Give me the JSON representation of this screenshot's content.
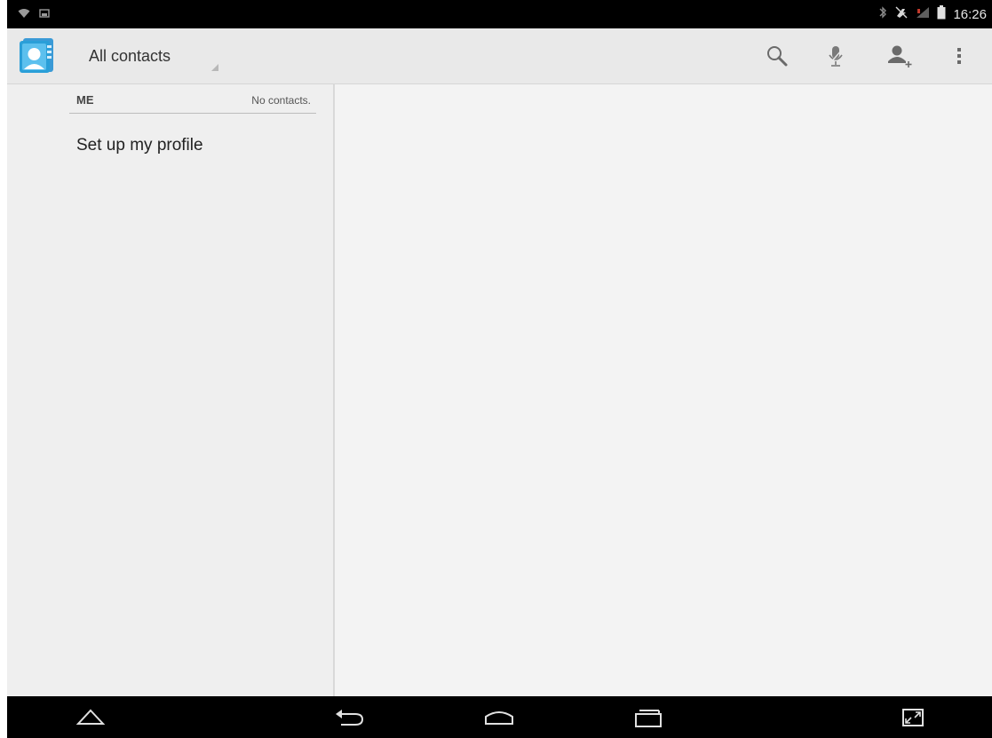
{
  "status_bar": {
    "time": "16:26",
    "icons": [
      "wifi-icon",
      "screenshot-notification-icon",
      "bluetooth-icon",
      "mute-icon",
      "signal-icon",
      "battery-icon"
    ]
  },
  "action_bar": {
    "app_icon": "contacts-app-icon",
    "filter_label": "All contacts",
    "actions": [
      "search-icon",
      "voice-search-icon",
      "add-contact-icon",
      "overflow-menu-icon"
    ]
  },
  "list": {
    "section_title": "ME",
    "section_count": "No contacts.",
    "profile_label": "Set up my profile"
  },
  "nav_bar": {
    "buttons": [
      "up-icon",
      "back-icon",
      "home-icon",
      "recent-apps-icon",
      "compatibility-zoom-icon"
    ]
  },
  "colors": {
    "status_bar": "#000000",
    "action_bar": "#e9e9e9",
    "list_pane": "#efefef",
    "detail_pane": "#f3f3f3",
    "app_icon_blue": "#2a9fd8"
  }
}
